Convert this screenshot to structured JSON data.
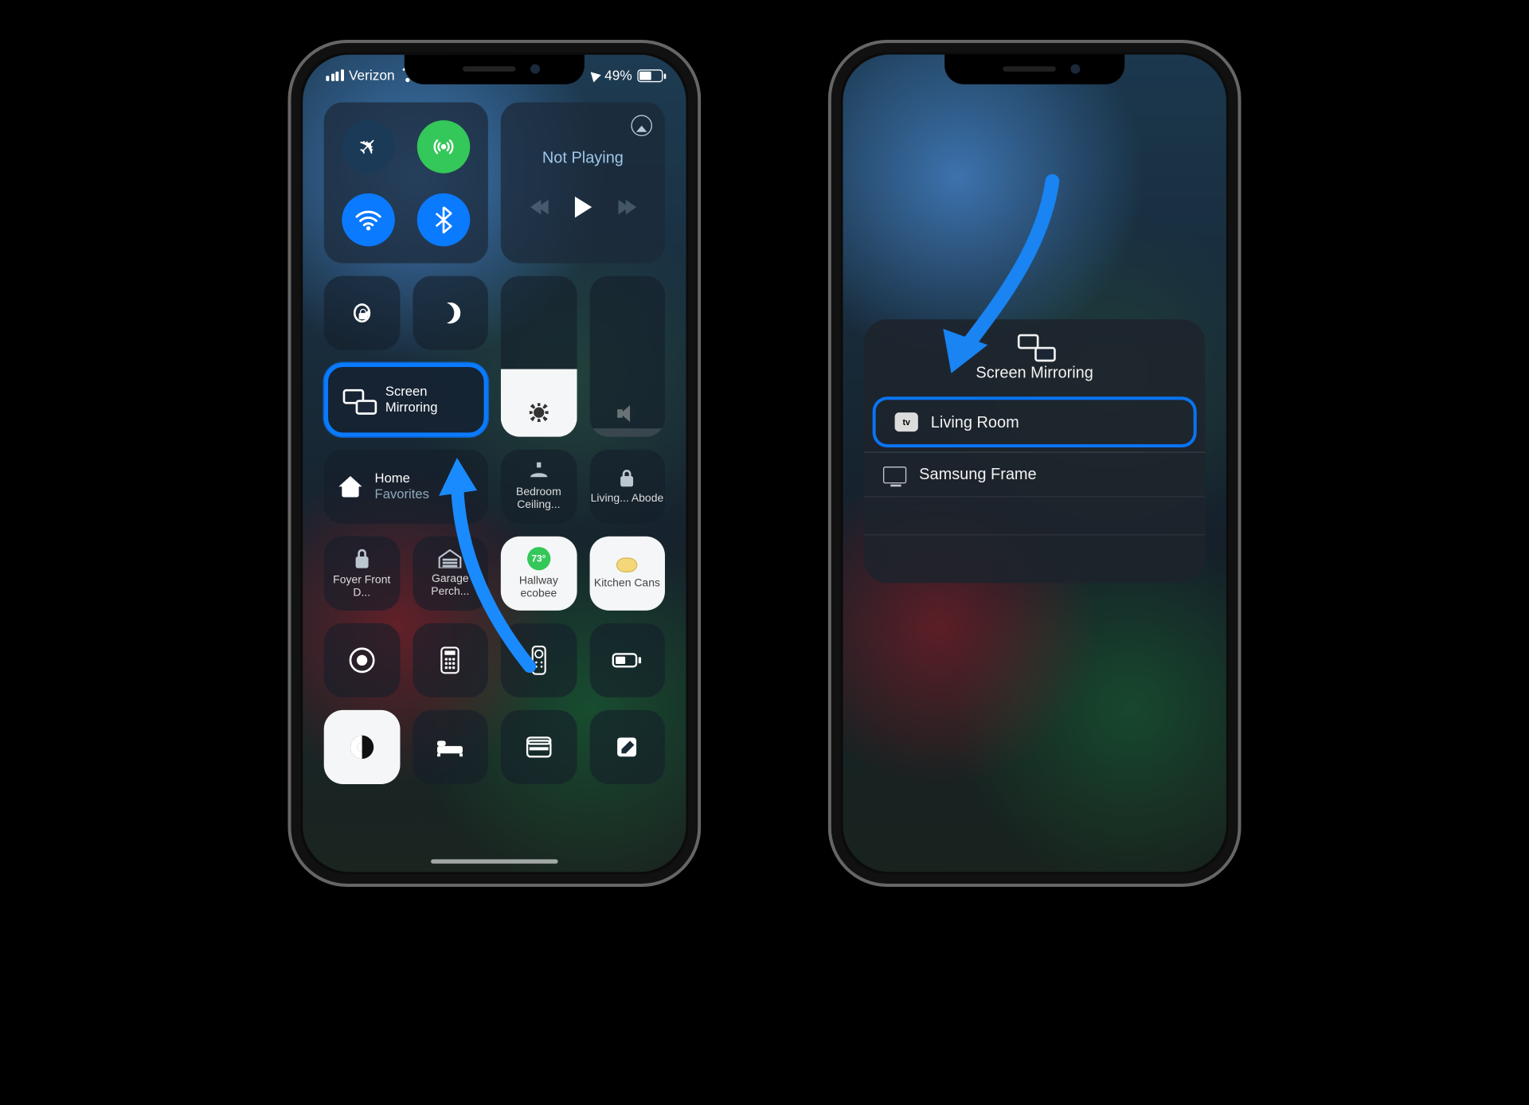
{
  "status": {
    "carrier": "Verizon",
    "battery_pct": "49%"
  },
  "connectivity": {
    "airplane": "airplane-mode",
    "cellular": "cellular-data",
    "wifi": "wifi",
    "bluetooth": "bluetooth"
  },
  "media": {
    "title": "Not Playing"
  },
  "tiles": {
    "orientation_lock": "Orientation Lock",
    "dnd": "Do Not Disturb",
    "mirror_line1": "Screen",
    "mirror_line2": "Mirroring",
    "brightness": "Brightness",
    "volume": "Volume",
    "home_label": "Home",
    "home_sub": "Favorites",
    "bedroom": "Bedroom Ceiling...",
    "living": "Living... Abode",
    "foyer": "Foyer Front D...",
    "garage": "Garage Perch...",
    "hallway_temp": "73°",
    "hallway": "Hallway ecobee",
    "kitchen": "Kitchen Cans",
    "record": "Screen Record",
    "calculator": "Calculator",
    "remote": "Apple TV Remote",
    "low_power": "Low Power",
    "dark_mode": "Dark Mode",
    "bedroom2": "Bedroom",
    "wallet": "Wallet",
    "notes": "Notes"
  },
  "popup": {
    "title": "Screen Mirroring",
    "devices": [
      {
        "name": "Living Room",
        "type": "appletv"
      },
      {
        "name": "Samsung Frame",
        "type": "tv"
      }
    ]
  }
}
